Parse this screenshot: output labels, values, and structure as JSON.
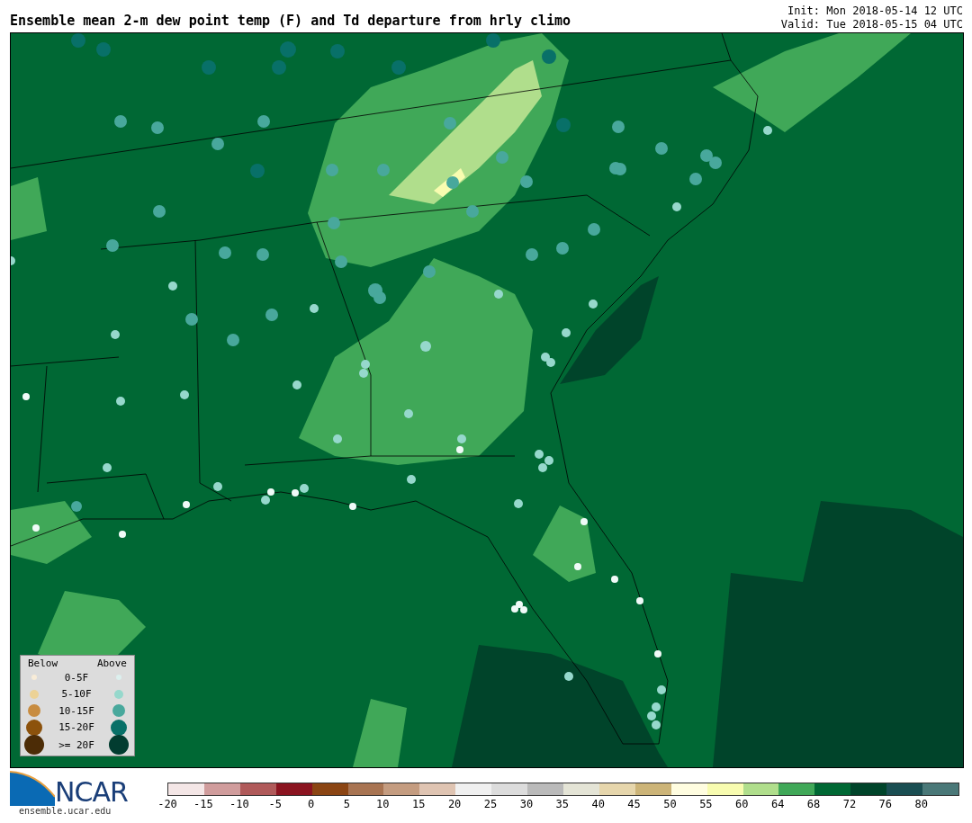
{
  "header": {
    "title": "Ensemble mean 2-m dew point temp (F) and Td departure from hrly climo",
    "init": "Init: Mon 2018-05-14 12 UTC",
    "valid": "Valid: Tue 2018-05-15 04 UTC"
  },
  "legend": {
    "below_heading": "Below",
    "above_heading": "Above",
    "rows": [
      {
        "label": "0-5F",
        "below": {
          "color": "#f8ecd8"
        },
        "above": {
          "color": "#dcf0ee"
        }
      },
      {
        "label": "5-10F",
        "below": {
          "color": "#ecd296"
        },
        "above": {
          "color": "#96d8cc"
        }
      },
      {
        "label": "10-15F",
        "below": {
          "color": "#c88c40"
        },
        "above": {
          "color": "#48a89c"
        }
      },
      {
        "label": "15-20F",
        "below": {
          "color": "#8c520c"
        },
        "above": {
          "color": "#087068"
        }
      },
      {
        "label": ">= 20F",
        "below": {
          "color": "#4c2c06"
        },
        "above": {
          "color": "#023c30"
        }
      }
    ]
  },
  "colorbar": {
    "segments": [
      {
        "color": "#f4e6e6"
      },
      {
        "color": "#d09c9c"
      },
      {
        "color": "#b05a5a"
      },
      {
        "color": "#8b1420"
      },
      {
        "color": "#8b4513"
      },
      {
        "color": "#a87452"
      },
      {
        "color": "#c49c80"
      },
      {
        "color": "#dfc4b2"
      },
      {
        "color": "#f0f0f0"
      },
      {
        "color": "#dcdcdc"
      },
      {
        "color": "#bababa"
      },
      {
        "color": "#e4e4d6"
      },
      {
        "color": "#e6d6ac"
      },
      {
        "color": "#ccb478"
      },
      {
        "color": "#fffde0"
      },
      {
        "color": "#f8fcb0"
      },
      {
        "color": "#b0de8c"
      },
      {
        "color": "#40a858"
      },
      {
        "color": "#006834"
      },
      {
        "color": "#00442a"
      },
      {
        "color": "#1a4e52"
      },
      {
        "color": "#4a7878"
      }
    ],
    "ticks": [
      "-20",
      "-15",
      "-10",
      "-5",
      "0",
      "5",
      "10",
      "15",
      "20",
      "25",
      "30",
      "35",
      "40",
      "45",
      "50",
      "55",
      "60",
      "64",
      "68",
      "72",
      "76",
      "80"
    ]
  },
  "logo": {
    "name": "NCAR",
    "url": "ensemble.ucar.edu"
  }
}
